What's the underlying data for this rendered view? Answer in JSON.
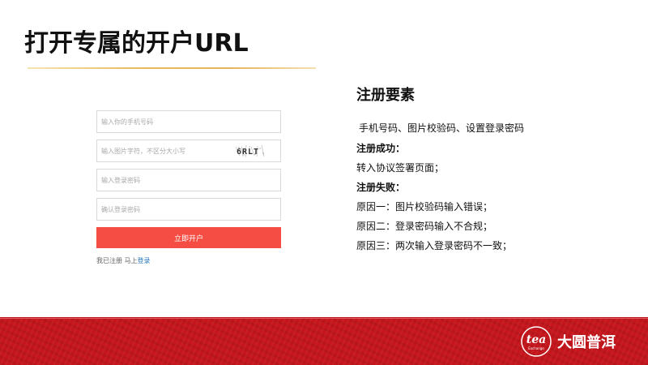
{
  "slide": {
    "title": "打开专属的开户URL"
  },
  "form": {
    "phone_placeholder": "输入你的手机号码",
    "captcha_placeholder": "输入图片字符，不区分大小写",
    "captcha_text": "6RLT",
    "password_placeholder": "输入登录密码",
    "confirm_placeholder": "确认登录密码",
    "submit_label": "立即开户",
    "login_prompt": "我已注册  马上",
    "login_link": "登录"
  },
  "requirements": {
    "heading": "注册要素",
    "items": "手机号码、图片校验码、设置登录密码",
    "success_label": "注册成功：",
    "success_text": "转入协议签署页面；",
    "failure_label": "注册失败：",
    "reason1": "原因一：图片校验码输入错误；",
    "reason2": "原因二：登录密码输入不合规；",
    "reason3": "原因三：两次输入登录密码不一致；"
  },
  "footer": {
    "logo_text": "tea",
    "logo_sub": "Exchange",
    "brand_name": "大圆普洱",
    "band_color": "#c4161c"
  },
  "colors": {
    "submit": "#f54d43",
    "link": "#2a7ac0",
    "underline": "#e6b35a"
  }
}
